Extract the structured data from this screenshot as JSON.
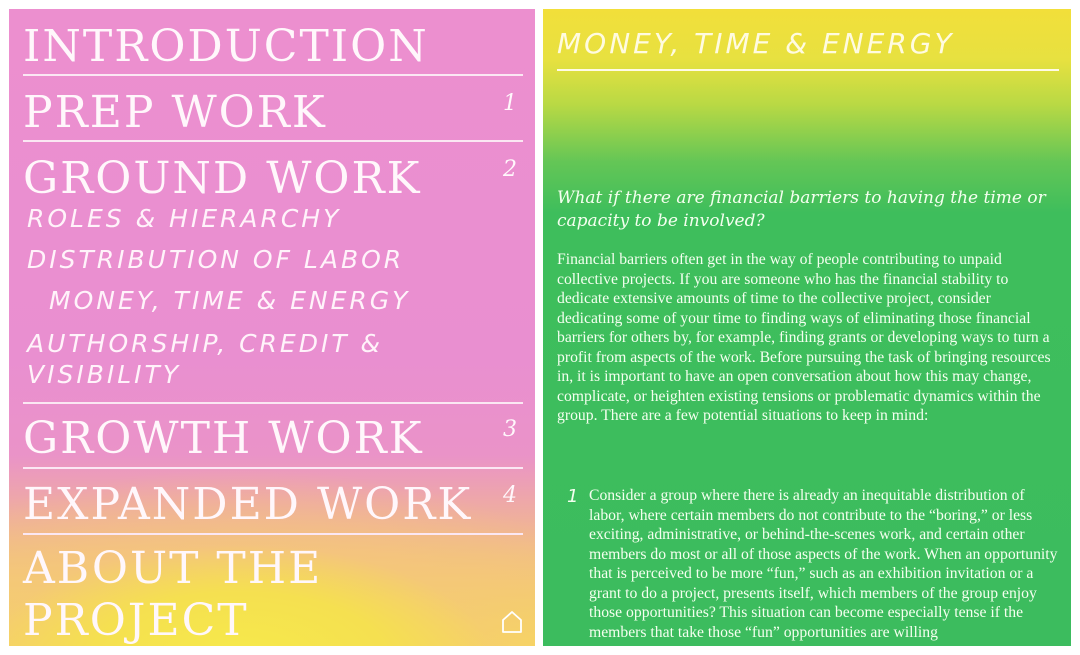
{
  "nav": {
    "introduction": "INTRODUCTION",
    "prep_work": "PREP WORK",
    "prep_num": "1",
    "ground_work": "GROUND WORK",
    "ground_num": "2",
    "sub_items": [
      "ROLES & HIERARCHY",
      "DISTRIBUTION OF LABOR",
      "MONEY, TIME & ENERGY",
      "AUTHORSHIP, CREDIT &",
      "VISIBILITY"
    ],
    "growth_work": "GROWTH WORK",
    "growth_num": "3",
    "expanded_work": "EXPANDED WORK",
    "expanded_num": "4",
    "about_line1": "ABOUT THE",
    "about_line2": "PROJECT",
    "home_icon": "home-icon"
  },
  "content": {
    "title": "MONEY, TIME & ENERGY",
    "question": "What if there are financial barriers to having the time or capacity to be involved?",
    "paragraph": "Financial barriers often get in the way of people contributing to unpaid collective projects. If you are someone who has the financial stability to dedicate extensive amounts of time to the collective project, consider dedicating some of your time to finding ways of eliminating those financial barriers for others by, for example, finding grants or developing ways to turn a profit from aspects of the work. Before pursuing the task of bringing resources in, it is important to have an open conversation about how this may change, complicate, or heighten existing tensions or problematic dynamics within the group. There are a few potential situations to keep in mind:",
    "list": [
      {
        "num": "1",
        "text": "Consider a group where there is already an inequitable distribution of labor, where certain members do not contribute to the “boring,” or less exciting, administrative, or behind-the-scenes work, and certain other members do most or all of those aspects of the work. When an opportunity that is perceived to be more “fun,” such as an exhibition invitation or a grant to do a project, presents itself, which members of the group enjoy those opportunities? This situation can become especially tense if the members that take those “fun” opportunities are willing"
      }
    ]
  },
  "colors": {
    "left_pink": "#ec8fcf",
    "left_yellow": "#f6ea4a",
    "right_yellow": "#f2df3a",
    "right_green": "#3cbc5e"
  }
}
